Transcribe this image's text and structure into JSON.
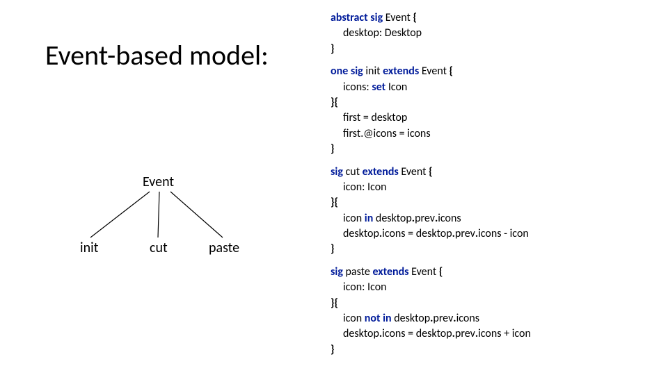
{
  "title": "Event-based model:",
  "tree": {
    "root": "Event",
    "leaves": {
      "init": "init",
      "cut": "cut",
      "paste": "paste"
    }
  },
  "code": {
    "l1_kw1": "abstract sig ",
    "l1_t": "Event ",
    "l1_b": "{",
    "l2": "desktop: Desktop",
    "l3": "}",
    "l4_kw1": "one sig ",
    "l4_t1": "init ",
    "l4_kw2": "extends ",
    "l4_t2": "Event ",
    "l4_b": "{",
    "l5_t1": "icons: ",
    "l5_kw1": "set ",
    "l5_t2": "Icon",
    "l6": "}{",
    "l7": "first = desktop",
    "l8": "first.@icons = icons",
    "l9": "}",
    "l10_kw1": "sig ",
    "l10_t1": "cut ",
    "l10_kw2": "extends ",
    "l10_t2": "Event ",
    "l10_b": "{",
    "l11": "icon: Icon",
    "l12": "}{",
    "l13_t1": "icon ",
    "l13_kw1": "in ",
    "l13_t2": "desktop",
    "l13_b1": ".",
    "l13_t3": "prev",
    "l13_b2": ".",
    "l13_t4": "icons",
    "l14_t1": "desktop",
    "l14_b1": ".",
    "l14_t2": "icons = desktop",
    "l14_b2": ".",
    "l14_t3": "prev",
    "l14_b3": ".",
    "l14_t4": "icons - icon",
    "l15": "}",
    "l16_kw1": "sig ",
    "l16_t1": "paste ",
    "l16_kw2": "extends ",
    "l16_t2": "Event ",
    "l16_b": "{",
    "l17": "icon: Icon",
    "l18": "}{",
    "l19_t1": "icon ",
    "l19_kw1": "not in ",
    "l19_t2": "desktop",
    "l19_b1": ".",
    "l19_t3": "prev",
    "l19_b2": ".",
    "l19_t4": "icons",
    "l20_t1": "desktop",
    "l20_b1": ".",
    "l20_t2": "icons = desktop",
    "l20_b2": ".",
    "l20_t3": "prev",
    "l20_b3": ".",
    "l20_t4": "icons + icon",
    "l21": "}"
  }
}
